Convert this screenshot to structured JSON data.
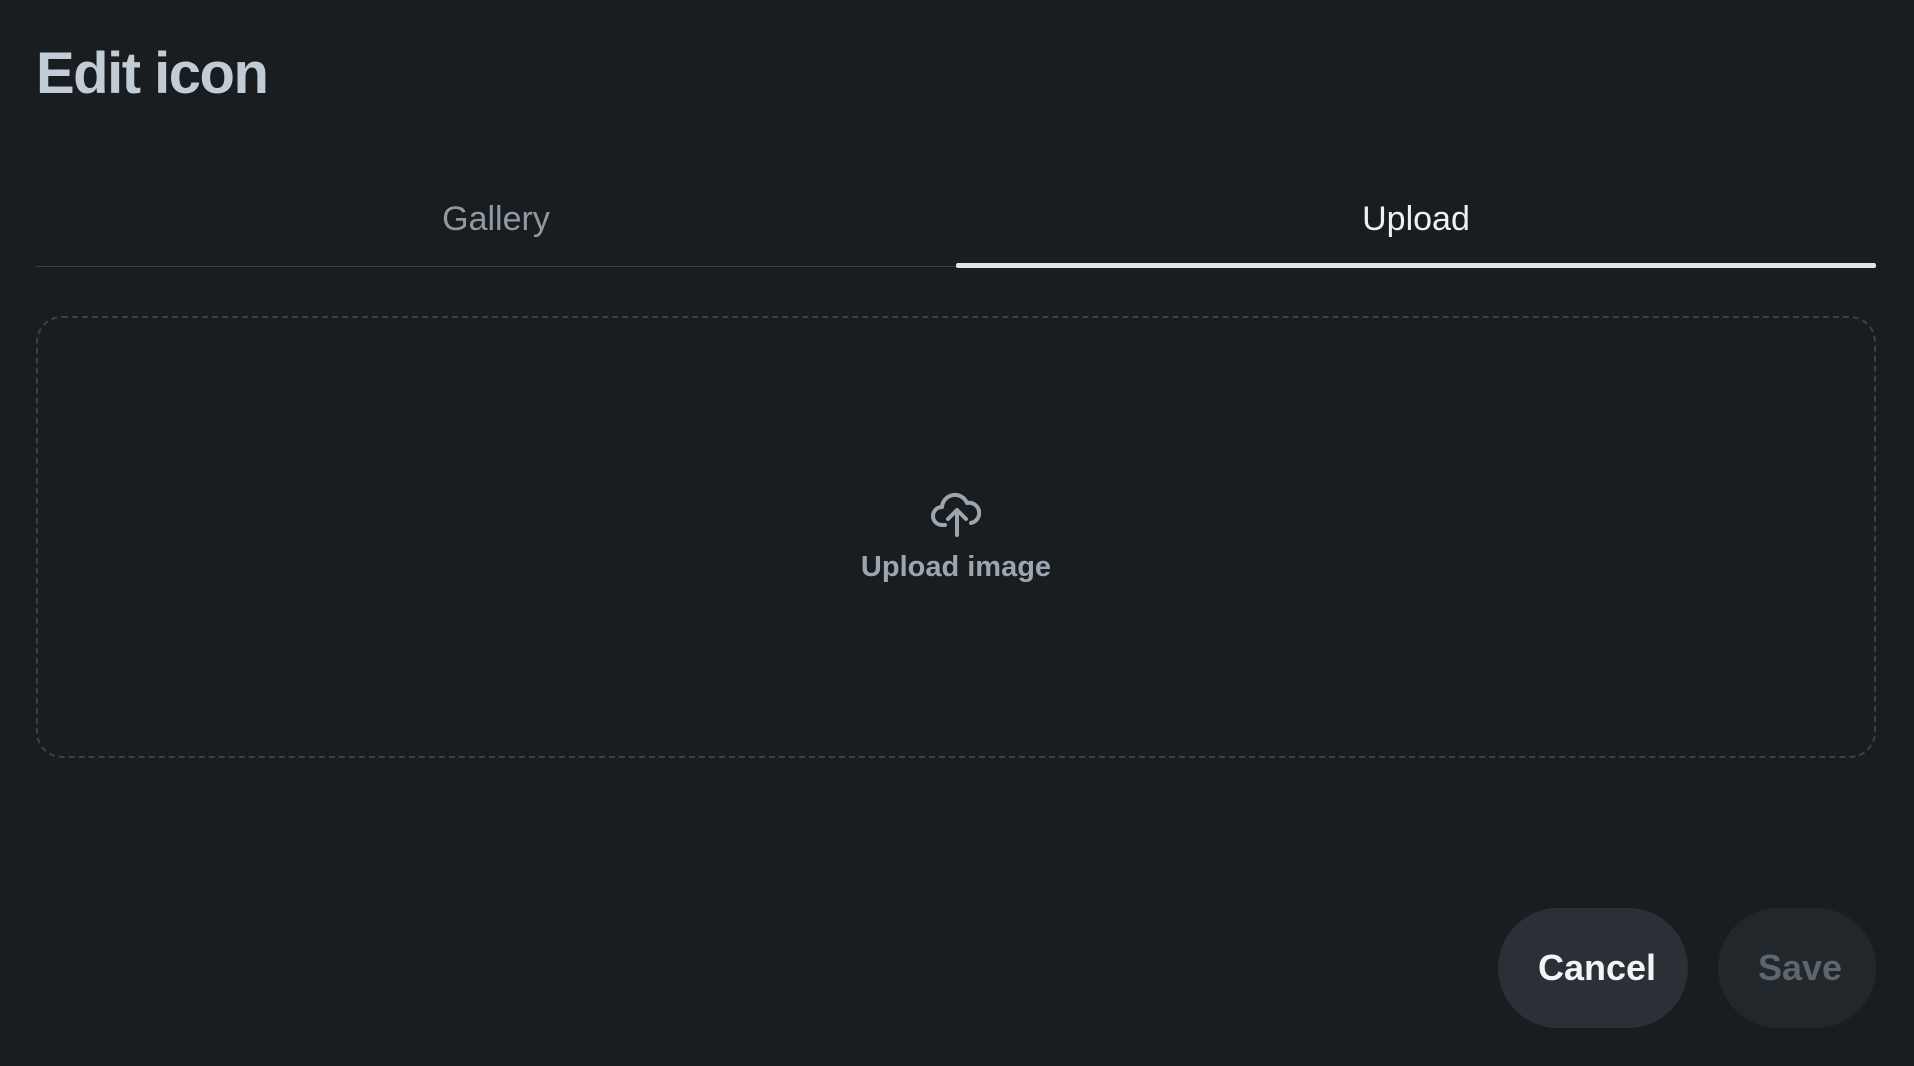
{
  "dialog": {
    "title": "Edit icon"
  },
  "tabs": [
    {
      "label": "Gallery",
      "active": false
    },
    {
      "label": "Upload",
      "active": true
    }
  ],
  "dropzone": {
    "icon": "cloud-upload-icon",
    "label": "Upload image"
  },
  "footer": {
    "cancel_label": "Cancel",
    "save_label": "Save"
  },
  "colors": {
    "background": "#1a1d20",
    "title": "#c2ccd4",
    "active_tab": "#eef1f3",
    "inactive_tab": "#8f9aa3",
    "muted": "#9aa6b0",
    "cancel_bg": "#2b3036",
    "save_bg": "#22272b"
  }
}
